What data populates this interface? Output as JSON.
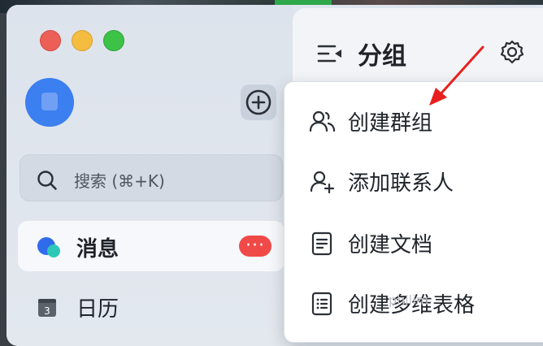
{
  "window": {
    "traffic_lights": [
      "close",
      "minimize",
      "maximize"
    ]
  },
  "sidebar": {
    "add_icon": "plus-circle-icon",
    "search": {
      "label": "搜索 (⌘+K)"
    },
    "nav": [
      {
        "label": "消息",
        "icon": "chat-bubble-icon",
        "badge": "···",
        "selected": true
      },
      {
        "label": "日历",
        "icon": "calendar-icon",
        "day": "3"
      }
    ]
  },
  "panel": {
    "title": "分组",
    "settings_icon": "gear-icon"
  },
  "menu": {
    "items": [
      {
        "label": "创建群组",
        "icon": "group-icon"
      },
      {
        "label": "添加联系人",
        "icon": "add-contact-icon"
      },
      {
        "label": "创建文档",
        "icon": "document-icon"
      },
      {
        "label": "创建多维表格",
        "icon": "table-icon"
      }
    ]
  },
  "colors": {
    "accent": "#3b7ff0",
    "badge": "#f04a48",
    "arrow": "#e8201d"
  }
}
